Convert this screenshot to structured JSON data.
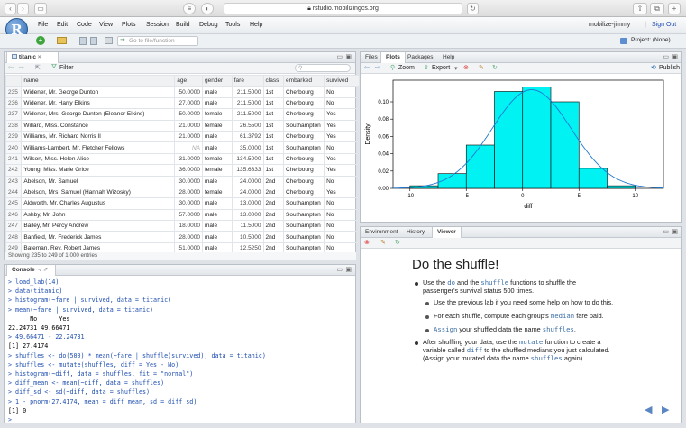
{
  "browser": {
    "url": "rstudio.mobilizingcs.org"
  },
  "menu": {
    "logo": "R",
    "items": [
      "File",
      "Edit",
      "Code",
      "View",
      "Plots",
      "Session",
      "Build",
      "Debug",
      "Tools",
      "Help"
    ],
    "user": "mobilize-jimmy",
    "sep": "|",
    "signout": "Sign Out",
    "goto_placeholder": "Go to file/function",
    "project": "Project: (None)"
  },
  "data_pane": {
    "tab": "titanic",
    "filter": "Filter",
    "columns": [
      "",
      "name",
      "age",
      "gender",
      "fare",
      "class",
      "embarked",
      "survived"
    ],
    "rows": [
      [
        "235",
        "Widener, Mr. George Dunton",
        "50.0000",
        "male",
        "211.5000",
        "1st",
        "Cherbourg",
        "No"
      ],
      [
        "236",
        "Widener, Mr. Harry Elkins",
        "27.0000",
        "male",
        "211.5000",
        "1st",
        "Cherbourg",
        "No"
      ],
      [
        "237",
        "Widener, Mrs. George Dunton (Eleanor Elkins)",
        "50.0000",
        "female",
        "211.5000",
        "1st",
        "Cherbourg",
        "Yes"
      ],
      [
        "238",
        "Willard, Miss. Constance",
        "21.0000",
        "female",
        "26.5500",
        "1st",
        "Southampton",
        "Yes"
      ],
      [
        "239",
        "Williams, Mr. Richard Norris II",
        "21.0000",
        "male",
        "61.3792",
        "1st",
        "Cherbourg",
        "Yes"
      ],
      [
        "240",
        "Williams-Lambert, Mr. Fletcher Fellows",
        "NA",
        "male",
        "35.0000",
        "1st",
        "Southampton",
        "No"
      ],
      [
        "241",
        "Wilson, Miss. Helen Alice",
        "31.0000",
        "female",
        "134.5000",
        "1st",
        "Cherbourg",
        "Yes"
      ],
      [
        "242",
        "Young, Miss. Marie Grice",
        "36.0000",
        "female",
        "135.6333",
        "1st",
        "Cherbourg",
        "Yes"
      ],
      [
        "243",
        "Abelson, Mr. Samuel",
        "30.0000",
        "male",
        "24.0000",
        "2nd",
        "Cherbourg",
        "No"
      ],
      [
        "244",
        "Abelson, Mrs. Samuel (Hannah Wizosky)",
        "28.0000",
        "female",
        "24.0000",
        "2nd",
        "Cherbourg",
        "Yes"
      ],
      [
        "245",
        "Aldworth, Mr. Charles Augustus",
        "30.0000",
        "male",
        "13.0000",
        "2nd",
        "Southampton",
        "No"
      ],
      [
        "246",
        "Ashby, Mr. John",
        "57.0000",
        "male",
        "13.0000",
        "2nd",
        "Southampton",
        "No"
      ],
      [
        "247",
        "Bailey, Mr. Percy Andrew",
        "18.0000",
        "male",
        "11.5000",
        "2nd",
        "Southampton",
        "No"
      ],
      [
        "248",
        "Banfield, Mr. Frederick James",
        "28.0000",
        "male",
        "10.5000",
        "2nd",
        "Southampton",
        "No"
      ],
      [
        "249",
        "Bateman, Rev. Robert James",
        "51.0000",
        "male",
        "12.5250",
        "2nd",
        "Southampton",
        "No"
      ]
    ],
    "footer": "Showing 235 to 249 of 1,000 entries"
  },
  "console": {
    "tab": "Console",
    "path": "~/",
    "lines": [
      {
        "t": "> load_lab(14)",
        "k": "in"
      },
      {
        "t": "> data(titanic)",
        "k": "in"
      },
      {
        "t": "> histogram(~fare | survived, data = titanic)",
        "k": "in"
      },
      {
        "t": "> mean(~fare | survived, data = titanic)",
        "k": "in"
      },
      {
        "t": "      No      Yes",
        "k": "out"
      },
      {
        "t": "22.24731 49.66471",
        "k": "out"
      },
      {
        "t": "> 49.66471 - 22.24731",
        "k": "in"
      },
      {
        "t": "[1] 27.4174",
        "k": "out"
      },
      {
        "t": "> shuffles <- do(500) * mean(~fare | shuffle(survived), data = titanic)",
        "k": "in"
      },
      {
        "t": "> shuffles <- mutate(shuffles, diff = Yes - No)",
        "k": "in"
      },
      {
        "t": "> histogram(~diff, data = shuffles, fit = \"normal\")",
        "k": "in"
      },
      {
        "t": "> diff_mean <- mean(~diff, data = shuffles)",
        "k": "in"
      },
      {
        "t": "> diff_sd <- sd(~diff, data = shuffles)",
        "k": "in"
      },
      {
        "t": "> 1 - pnorm(27.4174, mean = diff_mean, sd = diff_sd)",
        "k": "in"
      },
      {
        "t": "[1] 0",
        "k": "out"
      },
      {
        "t": ">",
        "k": "in"
      }
    ]
  },
  "plots_pane": {
    "tabs": [
      "Files",
      "Plots",
      "Packages",
      "Help"
    ],
    "zoom": "Zoom",
    "export": "Export",
    "publish": "Publish"
  },
  "chart_data": {
    "type": "bar",
    "xlabel": "diff",
    "ylabel": "Density",
    "xlim": [
      -11.5,
      12.5
    ],
    "ylim": [
      0,
      0.125
    ],
    "xticks": [
      -10,
      -5,
      0,
      5,
      10
    ],
    "yticks": [
      0.0,
      0.02,
      0.04,
      0.06,
      0.08,
      0.1
    ],
    "bins": [
      {
        "x0": -10,
        "x1": -7.5,
        "y": 0.003
      },
      {
        "x0": -7.5,
        "x1": -5,
        "y": 0.017
      },
      {
        "x0": -5,
        "x1": -2.5,
        "y": 0.05
      },
      {
        "x0": -2.5,
        "x1": 0,
        "y": 0.112
      },
      {
        "x0": 0,
        "x1": 2.5,
        "y": 0.117
      },
      {
        "x0": 2.5,
        "x1": 5,
        "y": 0.1
      },
      {
        "x0": 5,
        "x1": 7.5,
        "y": 0.023
      },
      {
        "x0": 7.5,
        "x1": 10,
        "y": 0.003
      }
    ],
    "fit": {
      "type": "normal",
      "mean": 0.8,
      "sd": 3.5
    },
    "bar_color": "#00f2f2",
    "line_color": "#1f78d1"
  },
  "env_pane": {
    "tabs": [
      "Environment",
      "History",
      "Viewer"
    ]
  },
  "viewer": {
    "title": "Do the shuffle!",
    "b1": [
      {
        "t": "Use the "
      },
      {
        "t": "do",
        "m": 1
      },
      {
        "t": " and the "
      },
      {
        "t": "shuffle",
        "m": 1
      },
      {
        "t": " functions to shuffle the"
      }
    ],
    "b1b": "passenger's survival status 500 times.",
    "s1": "Use the previous lab if you need some help on how to do this.",
    "s2a": "For each shuffle, compute each group's ",
    "s2m": "median",
    "s2b": " fare paid.",
    "s3m": "Assign",
    "s3a": " your shuffled data the name ",
    "s3m2": "shuffles",
    "s3b": ".",
    "b2a": "After shuffling your data, use the ",
    "b2m": "mutate",
    "b2b": " function to create a",
    "b2c": "variable called ",
    "b2m2": "diff",
    "b2d": " to the shuffled medians you just calculated.",
    "b2e": "(Assign your mutated data the name ",
    "b2m3": "shuffles",
    "b2f": " again).",
    "nav_prev": "◀",
    "nav_next": "▶"
  }
}
